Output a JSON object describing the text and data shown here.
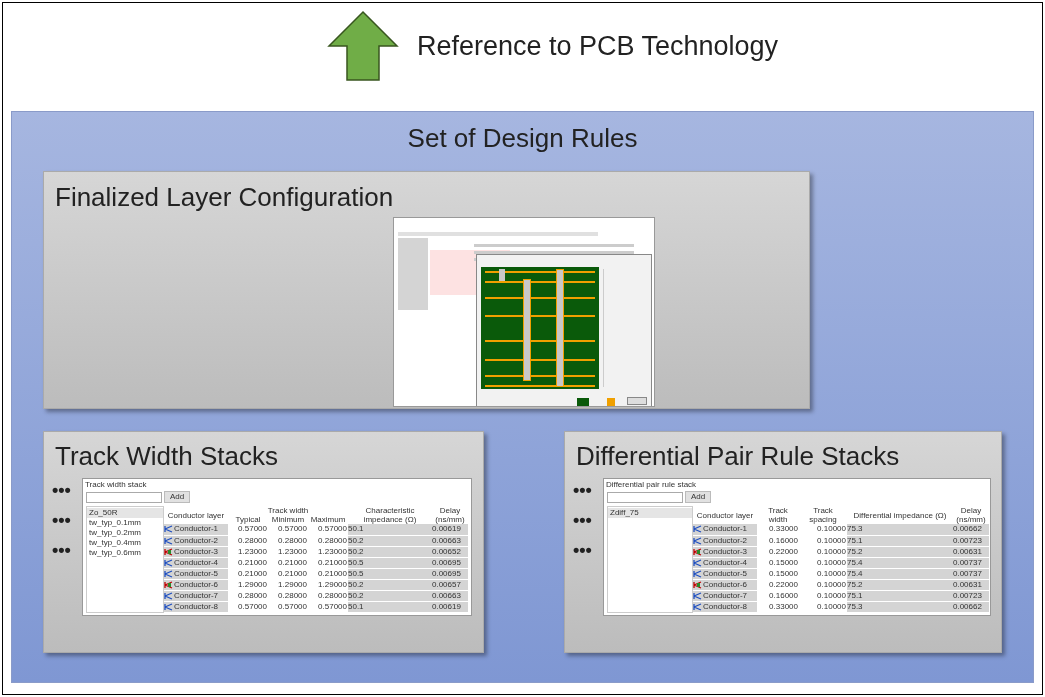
{
  "header": {
    "label": "Reference to PCB Technology"
  },
  "panel": {
    "title": "Set of Design Rules"
  },
  "layer_configuration": {
    "title": "Finalized Layer Configuration"
  },
  "stacks": [
    {
      "title": "Track Width Stacks",
      "ellipses": [
        "•••",
        "•••",
        "•••"
      ],
      "window_title": "Track width stack",
      "add_button": "Add",
      "list": [
        {
          "label": "Zo_50R",
          "selected": true
        },
        {
          "label": "tw_typ_0.1mm",
          "selected": false
        },
        {
          "label": "tw_typ_0.2mm",
          "selected": false
        },
        {
          "label": "tw_typ_0.4mm",
          "selected": false
        },
        {
          "label": "tw_typ_0.6mm",
          "selected": false
        }
      ],
      "header_rows": [
        [
          {
            "label": "Conductor layer",
            "rowspan": 2
          },
          {
            "label": "Track width",
            "colspan": 3
          },
          {
            "label": "Characteristic impedance (Ω)",
            "rowspan": 2
          },
          {
            "label": "Delay (ns/mm)",
            "rowspan": 2
          }
        ],
        [
          {
            "label": "Typical"
          },
          {
            "label": "Minimum"
          },
          {
            "label": "Maximum"
          }
        ]
      ],
      "rows": [
        {
          "kind": "signal",
          "cells": [
            "Conductor-1",
            "0.57000",
            "0.57000",
            "0.57000",
            "50.1",
            "0.00619"
          ]
        },
        {
          "kind": "signal",
          "cells": [
            "Conductor-2",
            "0.28000",
            "0.28000",
            "0.28000",
            "50.2",
            "0.00663"
          ]
        },
        {
          "kind": "plane",
          "cells": [
            "Conductor-3",
            "1.23000",
            "1.23000",
            "1.23000",
            "50.2",
            "0.00652"
          ]
        },
        {
          "kind": "signal",
          "cells": [
            "Conductor-4",
            "0.21000",
            "0.21000",
            "0.21000",
            "50.5",
            "0.00695"
          ]
        },
        {
          "kind": "signal",
          "cells": [
            "Conductor-5",
            "0.21000",
            "0.21000",
            "0.21000",
            "50.5",
            "0.00695"
          ]
        },
        {
          "kind": "plane",
          "cells": [
            "Conductor-6",
            "1.29000",
            "1.29000",
            "1.29000",
            "50.2",
            "0.00657"
          ]
        },
        {
          "kind": "signal",
          "cells": [
            "Conductor-7",
            "0.28000",
            "0.28000",
            "0.28000",
            "50.2",
            "0.00663"
          ]
        },
        {
          "kind": "signal",
          "cells": [
            "Conductor-8",
            "0.57000",
            "0.57000",
            "0.57000",
            "50.1",
            "0.00619"
          ]
        }
      ]
    },
    {
      "title": "Differential Pair Rule Stacks",
      "ellipses": [
        "•••",
        "•••",
        "•••"
      ],
      "window_title": "Differential pair rule stack",
      "add_button": "Add",
      "list": [
        {
          "label": "Zdiff_75",
          "selected": true
        }
      ],
      "header_rows": [
        [
          {
            "label": "Conductor layer"
          },
          {
            "label": "Track width"
          },
          {
            "label": "Track spacing"
          },
          {
            "label": "Differential impedance (Ω)"
          },
          {
            "label": "Delay (ns/mm)"
          }
        ]
      ],
      "rows": [
        {
          "kind": "signal",
          "cells": [
            "Conductor-1",
            "0.33000",
            "0.10000",
            "75.3",
            "0.00662"
          ]
        },
        {
          "kind": "signal",
          "cells": [
            "Conductor-2",
            "0.16000",
            "0.10000",
            "75.1",
            "0.00723"
          ]
        },
        {
          "kind": "plane",
          "cells": [
            "Conductor-3",
            "0.22000",
            "0.10000",
            "75.2",
            "0.00631"
          ]
        },
        {
          "kind": "signal",
          "cells": [
            "Conductor-4",
            "0.15000",
            "0.10000",
            "75.4",
            "0.00737"
          ]
        },
        {
          "kind": "signal",
          "cells": [
            "Conductor-5",
            "0.15000",
            "0.10000",
            "75.4",
            "0.00737"
          ]
        },
        {
          "kind": "plane",
          "cells": [
            "Conductor-6",
            "0.22000",
            "0.10000",
            "75.2",
            "0.00631"
          ]
        },
        {
          "kind": "signal",
          "cells": [
            "Conductor-7",
            "0.16000",
            "0.10000",
            "75.1",
            "0.00723"
          ]
        },
        {
          "kind": "signal",
          "cells": [
            "Conductor-8",
            "0.33000",
            "0.10000",
            "75.3",
            "0.00662"
          ]
        }
      ]
    }
  ]
}
